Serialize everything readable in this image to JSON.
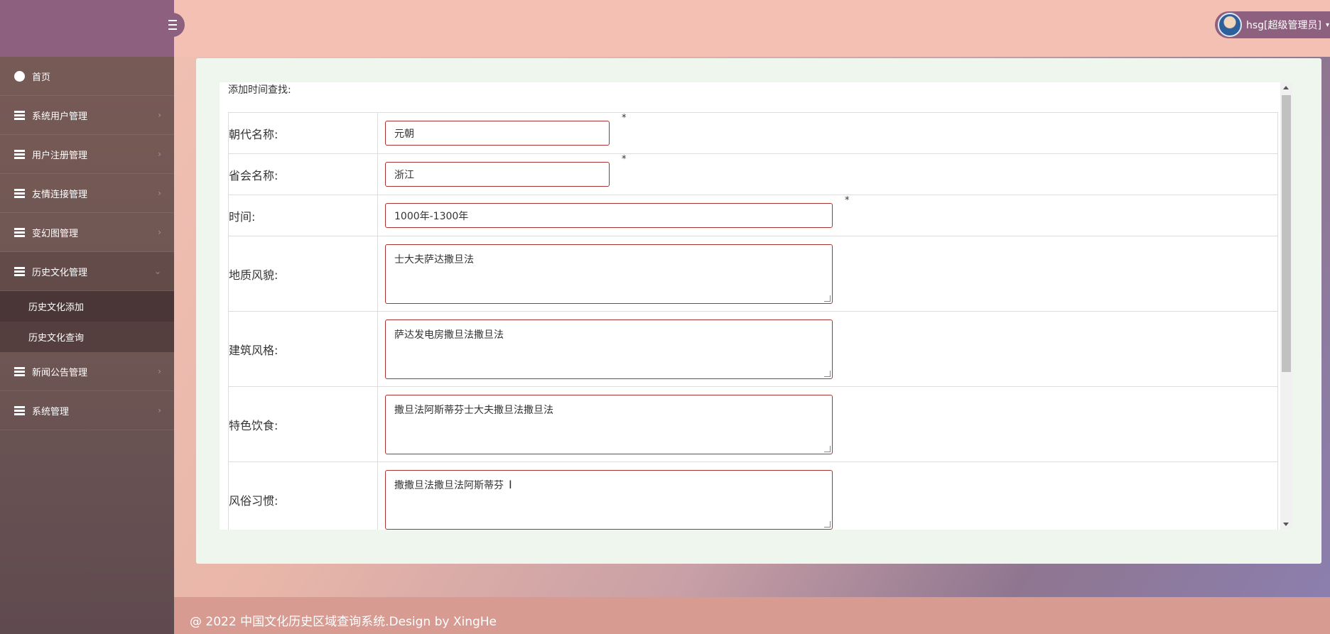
{
  "header": {
    "user_label": "hsg[超级管理员]"
  },
  "sidebar": {
    "items": [
      {
        "label": "首页"
      },
      {
        "label": "系统用户管理"
      },
      {
        "label": "用户注册管理"
      },
      {
        "label": "友情连接管理"
      },
      {
        "label": "变幻图管理"
      },
      {
        "label": "历史文化管理"
      },
      {
        "label": "新闻公告管理"
      },
      {
        "label": "系统管理"
      }
    ],
    "subitems": [
      {
        "label": "历史文化添加"
      },
      {
        "label": "历史文化查询"
      }
    ]
  },
  "form": {
    "title": "添加时间查找:",
    "fields": [
      {
        "label": "朝代名称:",
        "value": "元朝"
      },
      {
        "label": "省会名称:",
        "value": "浙江"
      },
      {
        "label": "时间:",
        "value": "1000年-1300年"
      },
      {
        "label": "地质风貌:",
        "value": "士大夫萨达撒旦法"
      },
      {
        "label": "建筑风格:",
        "value": "萨达发电房撒旦法撒旦法"
      },
      {
        "label": "特色饮食:",
        "value": "撒旦法阿斯蒂芬士大夫撒旦法撒旦法"
      },
      {
        "label": "风俗习惯:",
        "value": "撒撒旦法撒旦法阿斯蒂芬"
      }
    ],
    "required_mark": "*"
  },
  "footer": {
    "text": "@ 2022 中国文化历史区域查询系统.Design by XingHe"
  }
}
